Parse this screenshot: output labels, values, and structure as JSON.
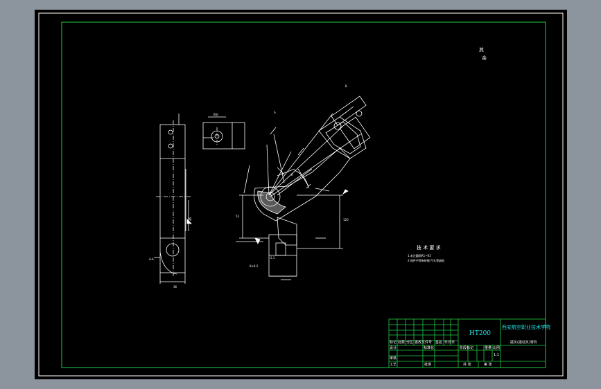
{
  "drawing": {
    "top_note": {
      "line1": "其",
      "line2": "余"
    },
    "tech_req": {
      "title": "技 术 要 求",
      "line1": "1.未注圆角R1~R3",
      "line2": "2.铸件不得有砂眼,气孔等缺陷"
    },
    "section_label": "A-A",
    "view_label": "B向",
    "title_block": {
      "material": "HT200",
      "school": "西安航空职业技术学院",
      "part_name": "拨叉(拨动叉)零件",
      "scale": "1:1",
      "designer": "设计",
      "checker": "审核",
      "process": "工艺",
      "approve": "批准",
      "header_cells": [
        "标记",
        "处数",
        "分区",
        "更改文件号",
        "签名",
        "年月日"
      ],
      "stage_label": "阶段标记",
      "weight_label": "重量",
      "scale_label": "比例",
      "sheets_label": "共 张",
      "sheet_label": "第 张",
      "std": "标准化"
    }
  },
  "colors": {
    "background": "#8c949e",
    "canvas": "#000000",
    "border_green": "#22cc44",
    "lines": "#ffffff",
    "title_cyan": "#22e5e5"
  }
}
